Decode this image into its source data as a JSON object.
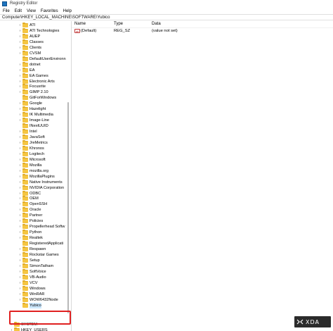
{
  "window": {
    "title": "Registry Editor"
  },
  "menu": [
    "File",
    "Edit",
    "View",
    "Favorites",
    "Help"
  ],
  "address": "Computer\\HKEY_LOCAL_MACHINE\\SOFTWARE\\Yubico",
  "tree": {
    "items": [
      {
        "label": "ATI",
        "expander": "›"
      },
      {
        "label": "ATI Technologies",
        "expander": "›"
      },
      {
        "label": "AUEP",
        "expander": "›"
      },
      {
        "label": "Classes",
        "expander": "›"
      },
      {
        "label": "Clients",
        "expander": "›"
      },
      {
        "label": "CVSM",
        "expander": "›"
      },
      {
        "label": "DefaultUserEnvironn",
        "expander": ""
      },
      {
        "label": "dotnet",
        "expander": "›"
      },
      {
        "label": "EA",
        "expander": "›"
      },
      {
        "label": "EA Games",
        "expander": "›"
      },
      {
        "label": "Electronic Arts",
        "expander": "›"
      },
      {
        "label": "Focusrite",
        "expander": "›"
      },
      {
        "label": "GIMP 2.10",
        "expander": "›"
      },
      {
        "label": "GitForWindows",
        "expander": ""
      },
      {
        "label": "Google",
        "expander": "›"
      },
      {
        "label": "Hazelight",
        "expander": "›"
      },
      {
        "label": "IK Multimedia",
        "expander": "›"
      },
      {
        "label": "Image-Line",
        "expander": "›"
      },
      {
        "label": "INextUUID",
        "expander": ""
      },
      {
        "label": "Intel",
        "expander": "›"
      },
      {
        "label": "JavaSoft",
        "expander": "›"
      },
      {
        "label": "JreMetrics",
        "expander": "›"
      },
      {
        "label": "Khronos",
        "expander": "›"
      },
      {
        "label": "Logitech",
        "expander": "›"
      },
      {
        "label": "Microsoft",
        "expander": "›"
      },
      {
        "label": "Mozilla",
        "expander": "›"
      },
      {
        "label": "mozilla.org",
        "expander": "›"
      },
      {
        "label": "MozillaPlugins",
        "expander": "›"
      },
      {
        "label": "Native Instruments",
        "expander": "›"
      },
      {
        "label": "NVIDIA Corporation",
        "expander": "›"
      },
      {
        "label": "ODBC",
        "expander": "›"
      },
      {
        "label": "OEM",
        "expander": "›"
      },
      {
        "label": "OpenSSH",
        "expander": "›"
      },
      {
        "label": "Oracle",
        "expander": "›"
      },
      {
        "label": "Partner",
        "expander": "›"
      },
      {
        "label": "Policies",
        "expander": "›"
      },
      {
        "label": "Propellerhead Softw",
        "expander": "›"
      },
      {
        "label": "Python",
        "expander": "›"
      },
      {
        "label": "Realtek",
        "expander": "›"
      },
      {
        "label": "RegisteredApplicati",
        "expander": ""
      },
      {
        "label": "Respawn",
        "expander": "›"
      },
      {
        "label": "Rockstar Games",
        "expander": "›"
      },
      {
        "label": "Setup",
        "expander": "›"
      },
      {
        "label": "SimonTatham",
        "expander": "›"
      },
      {
        "label": "SoftVoice",
        "expander": "›"
      },
      {
        "label": "VB-Audio",
        "expander": "›"
      },
      {
        "label": "VCV",
        "expander": "›"
      },
      {
        "label": "Windows",
        "expander": "›"
      },
      {
        "label": "WinRAR",
        "expander": "›"
      },
      {
        "label": "WOW6432Node",
        "expander": "›"
      },
      {
        "label": "Yubico",
        "expander": "",
        "selected": true
      },
      {
        "label": "SYSTEM",
        "expander": "›"
      },
      {
        "label": "HKEY_USERS",
        "expander": "›"
      }
    ]
  },
  "values": {
    "headers": {
      "name": "Name",
      "type": "Type",
      "data": "Data"
    },
    "rows": [
      {
        "icon": "string-value-icon",
        "icon_text": "ab",
        "name": "(Default)",
        "type": "REG_SZ",
        "data": "(value not set)"
      }
    ]
  },
  "watermark": {
    "text": "XDA",
    "icon": "xda-logo-icon"
  },
  "colors": {
    "highlight": "#e02020",
    "folder": "#f5c542",
    "selection": "#cce8ff"
  }
}
